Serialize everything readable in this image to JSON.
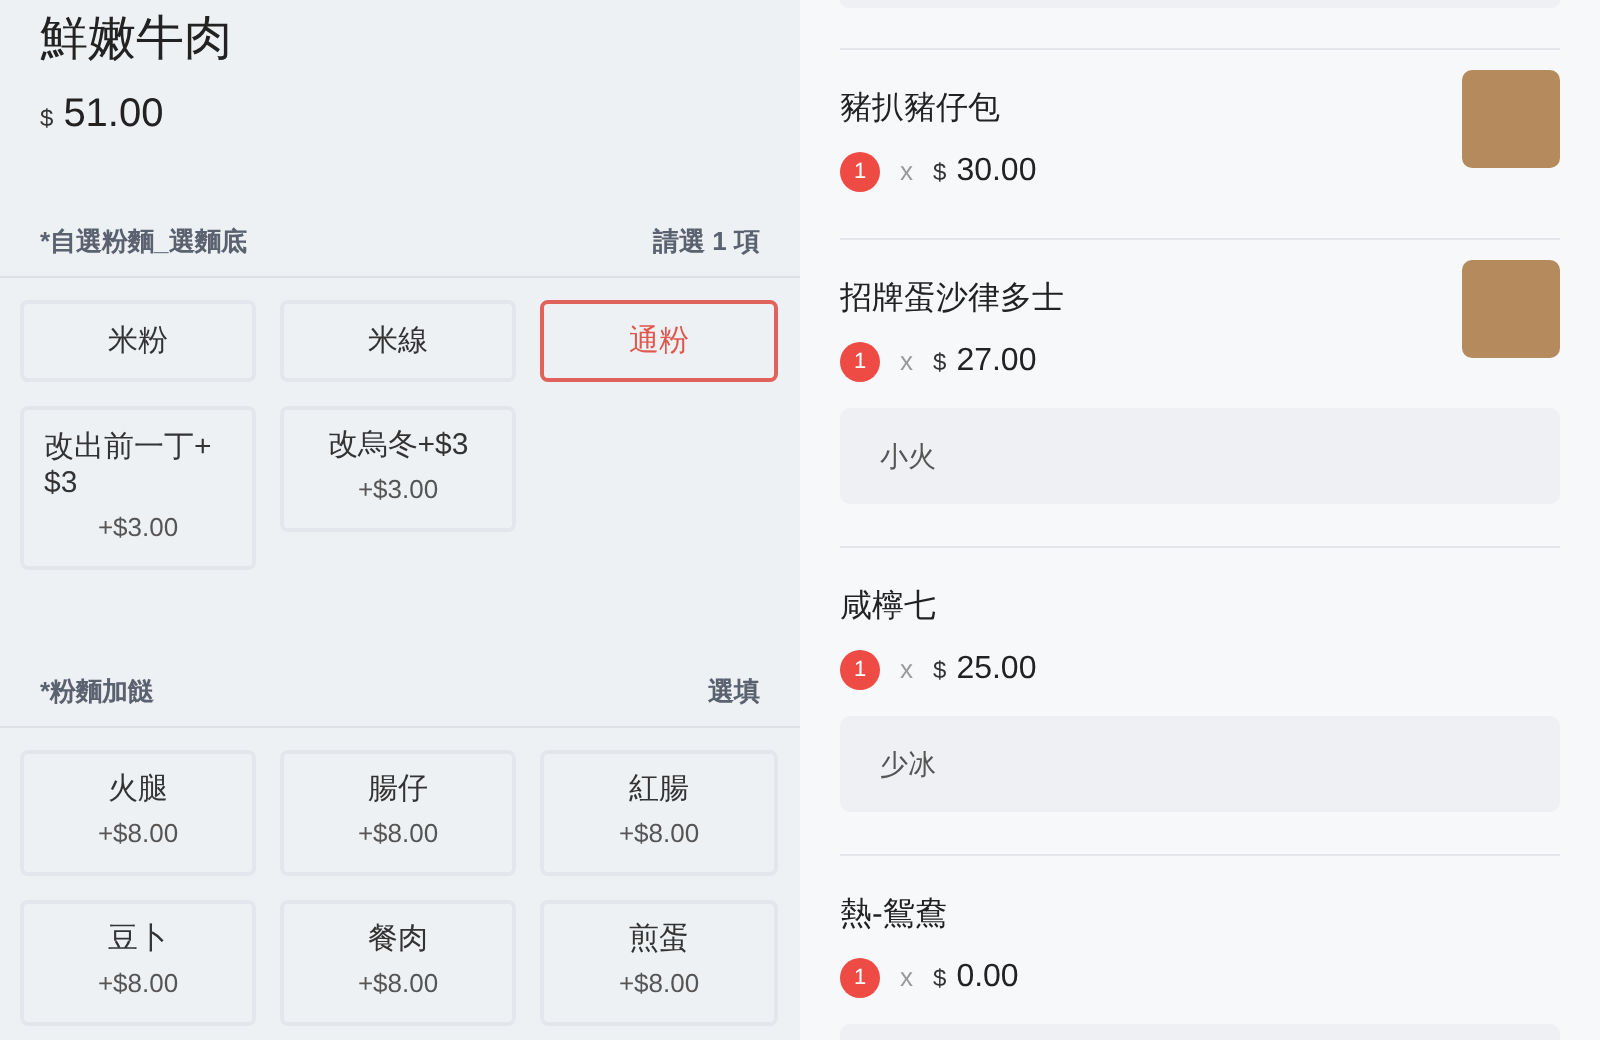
{
  "product": {
    "name": "鮮嫩牛肉",
    "currency": "$",
    "price": "51.00"
  },
  "option_groups": [
    {
      "title": "*自選粉麵_選麵底",
      "rule": "請選 1 項",
      "options": [
        {
          "label": "米粉",
          "selected": false
        },
        {
          "label": "米線",
          "selected": false
        },
        {
          "label": "通粉",
          "selected": true
        },
        {
          "label": "改出前一丁+$3",
          "price": "+$3.00",
          "selected": false
        },
        {
          "label": "改烏冬+$3",
          "price": "+$3.00",
          "selected": false
        }
      ]
    },
    {
      "title": "*粉麵加餸",
      "rule": "選填",
      "options": [
        {
          "label": "火腿",
          "price": "+$8.00",
          "selected": false
        },
        {
          "label": "腸仔",
          "price": "+$8.00",
          "selected": false
        },
        {
          "label": "紅腸",
          "price": "+$8.00",
          "selected": false
        },
        {
          "label": "豆卜",
          "price": "+$8.00",
          "selected": false
        },
        {
          "label": "餐肉",
          "price": "+$8.00",
          "selected": false
        },
        {
          "label": "煎蛋",
          "price": "+$8.00",
          "selected": false
        }
      ]
    }
  ],
  "cart": {
    "items": [
      {
        "name": "豬扒豬仔包",
        "quantity": "1",
        "times": "x",
        "currency": "$",
        "price": "30.00",
        "has_photo": true,
        "has_note": false
      },
      {
        "name": "招牌蛋沙律多士",
        "quantity": "1",
        "times": "x",
        "currency": "$",
        "price": "27.00",
        "has_photo": true,
        "has_note": true,
        "note": "小火"
      },
      {
        "name": "咸檸七",
        "quantity": "1",
        "times": "x",
        "currency": "$",
        "price": "25.00",
        "has_photo": false,
        "has_note": true,
        "note": "少冰"
      },
      {
        "name": "熱-鴛鴦",
        "quantity": "1",
        "times": "x",
        "currency": "$",
        "price": "0.00",
        "has_photo": false,
        "has_note": true
      }
    ]
  }
}
